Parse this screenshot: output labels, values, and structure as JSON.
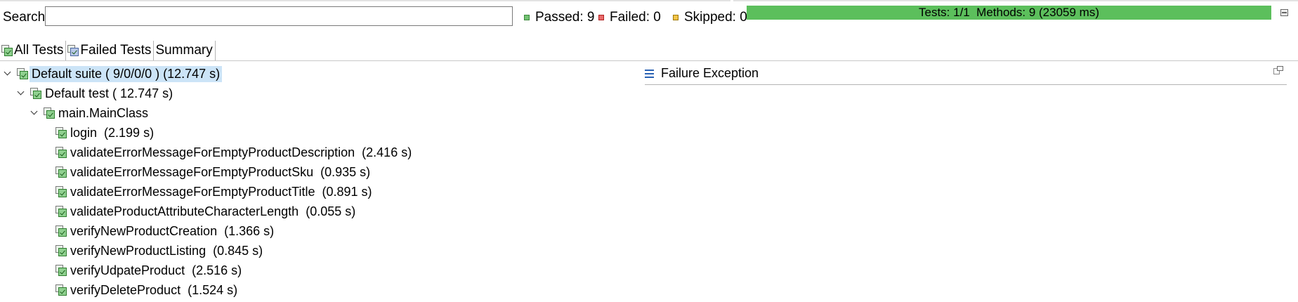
{
  "toolbar": {
    "search_label": "Search:",
    "search_value": "",
    "passed_label": "Passed: 9",
    "failed_label": "Failed: 0",
    "skipped_label": "Skipped: 0",
    "progress_text": "Tests: 1/1  Methods: 9 (23059 ms)",
    "progress_fraction": 1.0
  },
  "tabs": [
    {
      "label": "All Tests",
      "icon": "test-tree-icon",
      "active": true
    },
    {
      "label": "Failed Tests",
      "icon": "failed-tree-icon",
      "active": false
    },
    {
      "label": "Summary",
      "active": false
    }
  ],
  "tree": {
    "suite": "Default suite ( 9/0/0/0 ) (12.747 s)",
    "test": "Default test ( 12.747 s)",
    "class": "main.MainClass",
    "methods": [
      "login  (2.199 s)",
      "validateErrorMessageForEmptyProductDescription  (2.416 s)",
      "validateErrorMessageForEmptyProductSku  (0.935 s)",
      "validateErrorMessageForEmptyProductTitle  (0.891 s)",
      "validateProductAttributeCharacterLength  (0.055 s)",
      "verifyNewProductCreation  (1.366 s)",
      "verifyNewProductListing  (0.845 s)",
      "verifyUdpateProduct  (2.516 s)",
      "verifyDeleteProduct  (1.524 s)"
    ]
  },
  "failure_pane": {
    "title": "Failure Exception"
  },
  "colors": {
    "progress_pass": "#5cbf5c",
    "selection": "#cce4f7",
    "accent_blue": "#2a62b4"
  }
}
